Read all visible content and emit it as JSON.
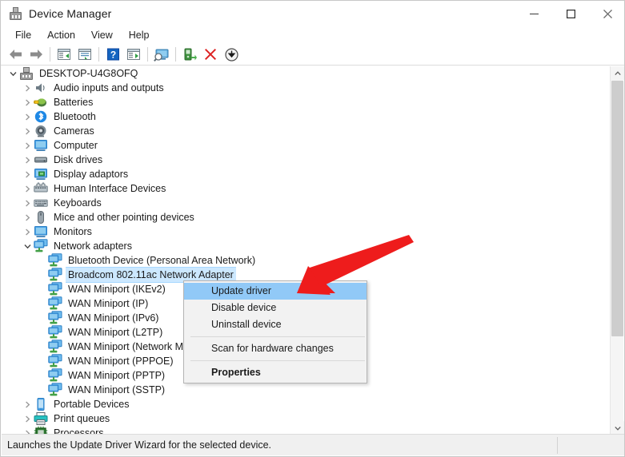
{
  "window": {
    "title": "Device Manager",
    "icon": "device-manager-icon",
    "controls": {
      "minimize": "minimize-icon",
      "maximize": "maximize-icon",
      "close": "close-icon"
    }
  },
  "menubar": {
    "items": [
      {
        "label": "File"
      },
      {
        "label": "Action"
      },
      {
        "label": "View"
      },
      {
        "label": "Help"
      }
    ]
  },
  "toolbar": {
    "buttons": [
      {
        "name": "back-icon",
        "tooltip": "Back"
      },
      {
        "name": "forward-icon",
        "tooltip": "Forward"
      },
      {
        "name": "show-hide-console-tree-icon",
        "tooltip": "Show/Hide Console Tree"
      },
      {
        "name": "properties-icon",
        "tooltip": "Properties"
      },
      {
        "name": "help-icon",
        "tooltip": "Help"
      },
      {
        "name": "show-hide-action-pane-icon",
        "tooltip": "Show/Hide Action Pane"
      },
      {
        "name": "scan-for-hardware-changes-icon",
        "tooltip": "Scan for hardware changes"
      },
      {
        "name": "update-driver-icon",
        "tooltip": "Update driver"
      },
      {
        "name": "uninstall-device-icon",
        "tooltip": "Uninstall device"
      },
      {
        "name": "disable-device-icon",
        "tooltip": "Disable device"
      }
    ]
  },
  "tree": {
    "root": {
      "label": "DESKTOP-U4G8OFQ",
      "expanded": true,
      "icon": "computer-root-icon"
    },
    "items": [
      {
        "label": "Audio inputs and outputs",
        "icon": "speaker-icon",
        "level": 1,
        "expanded": false,
        "selected": false
      },
      {
        "label": "Batteries",
        "icon": "battery-icon",
        "level": 1,
        "expanded": false,
        "selected": false
      },
      {
        "label": "Bluetooth",
        "icon": "bluetooth-icon",
        "level": 1,
        "expanded": false,
        "selected": false
      },
      {
        "label": "Cameras",
        "icon": "camera-icon",
        "level": 1,
        "expanded": false,
        "selected": false
      },
      {
        "label": "Computer",
        "icon": "computer-icon",
        "level": 1,
        "expanded": false,
        "selected": false
      },
      {
        "label": "Disk drives",
        "icon": "disk-drive-icon",
        "level": 1,
        "expanded": false,
        "selected": false
      },
      {
        "label": "Display adaptors",
        "icon": "display-adapter-icon",
        "level": 1,
        "expanded": false,
        "selected": false
      },
      {
        "label": "Human Interface Devices",
        "icon": "hid-icon",
        "level": 1,
        "expanded": false,
        "selected": false
      },
      {
        "label": "Keyboards",
        "icon": "keyboard-icon",
        "level": 1,
        "expanded": false,
        "selected": false
      },
      {
        "label": "Mice and other pointing devices",
        "icon": "mouse-icon",
        "level": 1,
        "expanded": false,
        "selected": false
      },
      {
        "label": "Monitors",
        "icon": "monitor-icon",
        "level": 1,
        "expanded": false,
        "selected": false
      },
      {
        "label": "Network adapters",
        "icon": "network-adapter-icon",
        "level": 1,
        "expanded": true,
        "selected": false
      },
      {
        "label": "Bluetooth Device (Personal Area Network)",
        "icon": "network-adapter-icon",
        "level": 2,
        "expanded": null,
        "selected": false
      },
      {
        "label": "Broadcom 802.11ac Network Adapter",
        "icon": "network-adapter-icon",
        "level": 2,
        "expanded": null,
        "selected": true
      },
      {
        "label": "WAN Miniport (IKEv2)",
        "icon": "network-adapter-icon",
        "level": 2,
        "expanded": null,
        "selected": false
      },
      {
        "label": "WAN Miniport (IP)",
        "icon": "network-adapter-icon",
        "level": 2,
        "expanded": null,
        "selected": false
      },
      {
        "label": "WAN Miniport (IPv6)",
        "icon": "network-adapter-icon",
        "level": 2,
        "expanded": null,
        "selected": false
      },
      {
        "label": "WAN Miniport (L2TP)",
        "icon": "network-adapter-icon",
        "level": 2,
        "expanded": null,
        "selected": false
      },
      {
        "label": "WAN Miniport (Network Monitor)",
        "icon": "network-adapter-icon",
        "level": 2,
        "expanded": null,
        "selected": false
      },
      {
        "label": "WAN Miniport (PPPOE)",
        "icon": "network-adapter-icon",
        "level": 2,
        "expanded": null,
        "selected": false
      },
      {
        "label": "WAN Miniport (PPTP)",
        "icon": "network-adapter-icon",
        "level": 2,
        "expanded": null,
        "selected": false
      },
      {
        "label": "WAN Miniport (SSTP)",
        "icon": "network-adapter-icon",
        "level": 2,
        "expanded": null,
        "selected": false
      },
      {
        "label": "Portable Devices",
        "icon": "portable-device-icon",
        "level": 1,
        "expanded": false,
        "selected": false
      },
      {
        "label": "Print queues",
        "icon": "printer-icon",
        "level": 1,
        "expanded": false,
        "selected": false
      },
      {
        "label": "Processors",
        "icon": "processor-icon",
        "level": 1,
        "expanded": false,
        "selected": false
      }
    ]
  },
  "context_menu": {
    "items": [
      {
        "label": "Update driver",
        "highlighted": true,
        "bold": false,
        "type": "item"
      },
      {
        "label": "Disable device",
        "highlighted": false,
        "bold": false,
        "type": "item"
      },
      {
        "label": "Uninstall device",
        "highlighted": false,
        "bold": false,
        "type": "item"
      },
      {
        "label": "",
        "type": "separator"
      },
      {
        "label": "Scan for hardware changes",
        "highlighted": false,
        "bold": false,
        "type": "item"
      },
      {
        "label": "",
        "type": "separator"
      },
      {
        "label": "Properties",
        "highlighted": false,
        "bold": true,
        "type": "item"
      }
    ]
  },
  "annotation": {
    "arrow": "red-pointer-arrow",
    "color": "#ee1c1c"
  },
  "statusbar": {
    "text": "Launches the Update Driver Wizard for the selected device."
  },
  "scrollbar": {
    "up": "scroll-up-arrow-icon",
    "down": "scroll-down-arrow-icon"
  },
  "colors": {
    "selection": "#cce8ff",
    "menu_highlight": "#91c9f7",
    "accent_blue": "#4aa3e8",
    "accent_green": "#43a047",
    "annotation_red": "#ee1c1c"
  }
}
